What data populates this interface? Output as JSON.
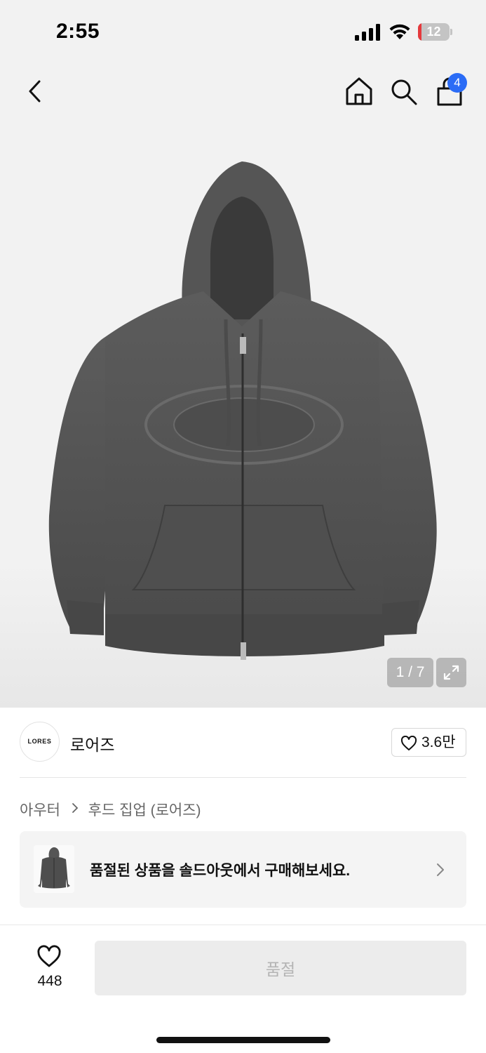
{
  "status_bar": {
    "time": "2:55",
    "battery_level": "12",
    "battery_percent": 0.12,
    "battery_color": "#e5393c"
  },
  "nav": {
    "back_icon": "chevron-left-icon",
    "home_icon": "home-icon",
    "search_icon": "search-icon",
    "cart_icon": "shopping-bag-icon",
    "cart_count": "4",
    "badge_color": "#2b6cf6"
  },
  "product": {
    "image_description_icon": "hoodie-image",
    "page_indicator": "1 / 7",
    "expand_icon": "expand-icon"
  },
  "brand": {
    "logo_text": "LORES",
    "name": "로어즈",
    "like_count": "3.6만"
  },
  "breadcrumb": {
    "category": "아우터",
    "subcategory": "후드 집업 (로어즈)"
  },
  "soldout_banner": {
    "text": "품절된 상품을 솔드아웃에서 구매해보세요."
  },
  "bottom_bar": {
    "wish_count": "448",
    "buy_label": "품절"
  }
}
